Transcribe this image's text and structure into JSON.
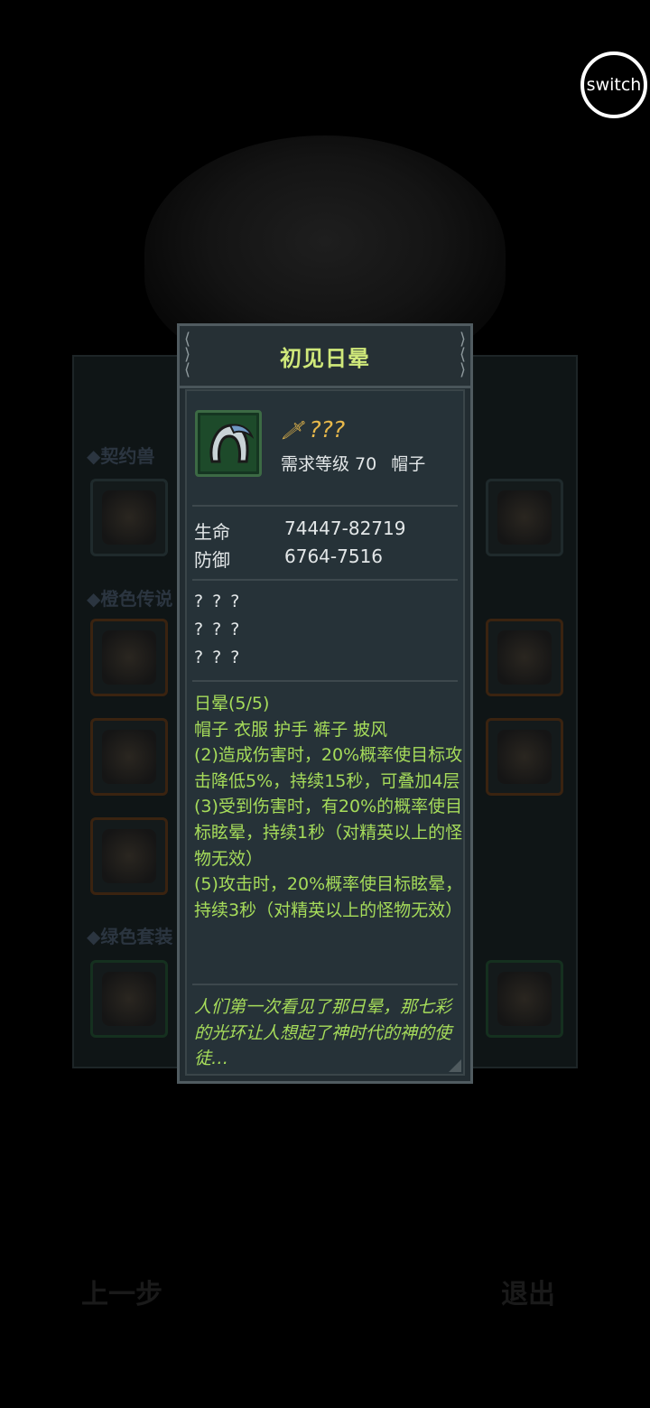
{
  "switch_label": "switch",
  "background": {
    "sections": [
      "◆契约兽",
      "◆橙色传说",
      "◆绿色套装"
    ],
    "nav_prev": "上一步",
    "nav_exit": "退出"
  },
  "tooltip": {
    "title": "初见日晕",
    "item": {
      "class_icon": "rogue-class-icon",
      "name": "???",
      "level_req": "需求等级 70",
      "slot": "帽子"
    },
    "stats": [
      {
        "label": "生命",
        "value": "74447-82719"
      },
      {
        "label": "防御",
        "value": "6764-7516"
      }
    ],
    "unknown_affixes": [
      "? ? ?",
      "? ? ?",
      "? ? ?"
    ],
    "set_bonus": {
      "name": "日晕(5/5)",
      "pieces": "帽子 衣服 护手 裤子 披风",
      "effects": [
        "(2)造成伤害时，20%概率使目标攻击降低5%，持续15秒，可叠加4层",
        "(3)受到伤害时，有20%的概率使目标眩晕，持续1秒（对精英以上的怪物无效）",
        "(5)攻击时，20%概率使目标眩晕，持续3秒（对精英以上的怪物无效）"
      ]
    },
    "flavor": "人们第一次看见了那日晕，那七彩的光环让人想起了神时代的神的使徒…"
  },
  "colors": {
    "title": "#cfe87a",
    "item_name": "#e7b84b",
    "set_text": "#a6dc5a",
    "item_frame": "#1d4a2a"
  }
}
